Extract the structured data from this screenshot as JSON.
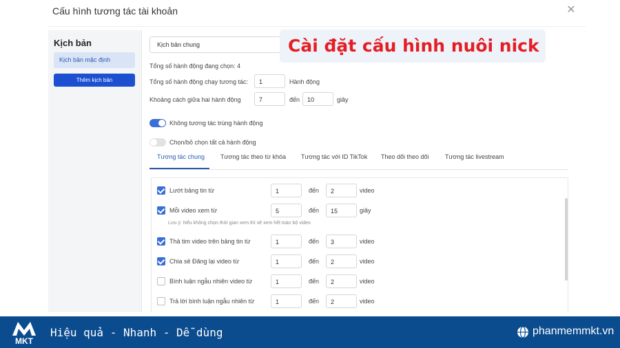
{
  "dialog": {
    "title": "Cấu hình tương tác tài khoản",
    "close_icon": "close-icon"
  },
  "sidebar": {
    "title": "Kịch bản",
    "items": [
      {
        "label": "Kịch bản mặc định"
      }
    ],
    "add_button": "Thêm kịch bản"
  },
  "scenario_select": {
    "value": "Kịch bản chung"
  },
  "banner": {
    "text": "Cài đặt cấu hình nuôi nick"
  },
  "summary": {
    "total_selected": "Tổng số hành động đang chọn: 4",
    "run_label": "Tổng số hành động chạy tương tác:",
    "run_value": "1",
    "run_unit": "Hành động",
    "gap_label": "Khoảng cách giữa hai hành động",
    "gap_from": "7",
    "gap_to_label": "đến",
    "gap_to": "10",
    "gap_unit": "giây"
  },
  "toggles": [
    {
      "label": "Không tương tác trùng hành động",
      "on": true
    },
    {
      "label": "Chọn/bỏ chọn tất cả hành động",
      "on": false
    }
  ],
  "tabs": [
    {
      "label": "Tương tác chung",
      "active": true
    },
    {
      "label": "Tương tác theo từ khóa",
      "active": false
    },
    {
      "label": "Tương tác với ID TikTok",
      "active": false
    },
    {
      "label": "Theo dõi theo dõi",
      "active": false
    },
    {
      "label": "Tương tác livestream",
      "active": false
    }
  ],
  "actions": [
    {
      "label": "Lướt bảng tin từ",
      "checked": true,
      "from": "1",
      "to_label": "đến",
      "to": "2",
      "unit": "video"
    },
    {
      "label": "Mỗi video xem từ",
      "checked": true,
      "from": "5",
      "to_label": "đến",
      "to": "15",
      "unit": "giây"
    },
    {
      "label": "Thả tim video trên bảng tin từ",
      "checked": true,
      "from": "1",
      "to_label": "đến",
      "to": "3",
      "unit": "video"
    },
    {
      "label": "Chia sẻ Đăng lại video từ",
      "checked": true,
      "from": "1",
      "to_label": "đến",
      "to": "2",
      "unit": "video"
    },
    {
      "label": "Bình luận ngẫu nhiên video từ",
      "checked": false,
      "from": "1",
      "to_label": "đến",
      "to": "2",
      "unit": "video"
    },
    {
      "label": "Trả lời bình luận ngẫu nhiên từ",
      "checked": false,
      "from": "1",
      "to_label": "đến",
      "to": "2",
      "unit": "video"
    }
  ],
  "note": "Lưu ý: Nếu không chọn thời gian xem thì sẽ xem hết toàn bộ video",
  "footer": {
    "logo_text": "MKT",
    "slogan": "Hiệu quả - Nhanh  - Dễ dùng",
    "site": "phanmemmkt.vn",
    "brand_color": "#0b4c8f"
  }
}
